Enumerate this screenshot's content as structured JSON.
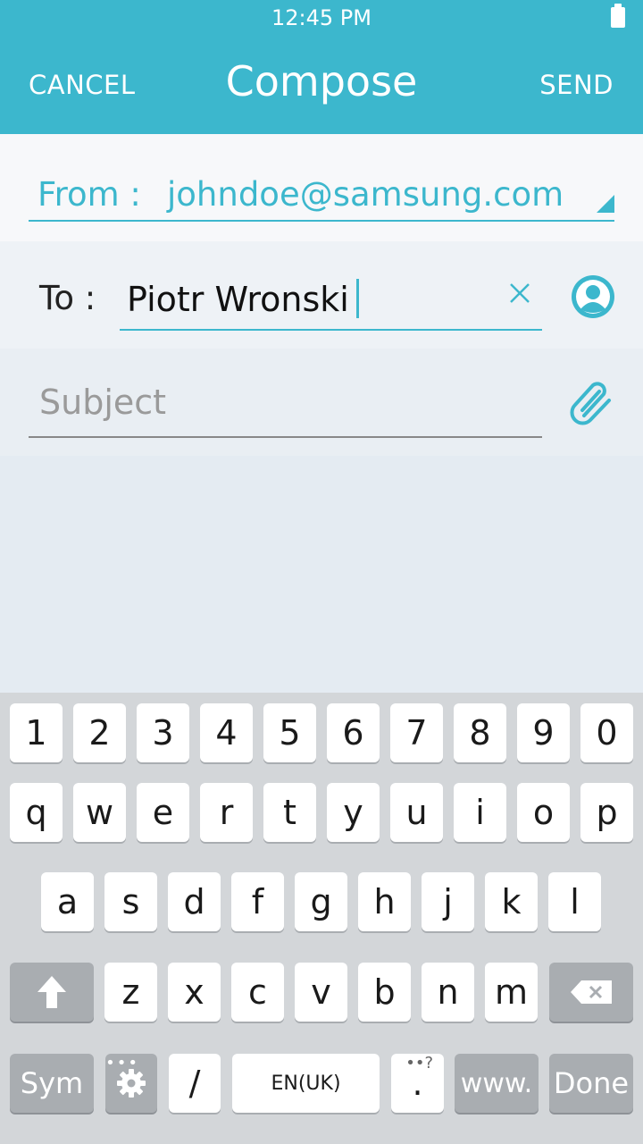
{
  "status": {
    "time": "12:45 PM"
  },
  "header": {
    "cancel_label": "CANCEL",
    "title": "Compose",
    "send_label": "SEND"
  },
  "from": {
    "label": "From :",
    "value": "johndoe@samsung.com"
  },
  "to": {
    "label": "To :",
    "value": "Piotr Wronski"
  },
  "subject": {
    "placeholder": "Subject"
  },
  "keyboard": {
    "row1": [
      "1",
      "2",
      "3",
      "4",
      "5",
      "6",
      "7",
      "8",
      "9",
      "0"
    ],
    "row2": [
      "q",
      "w",
      "e",
      "r",
      "t",
      "y",
      "u",
      "i",
      "o",
      "p"
    ],
    "row3": [
      "a",
      "s",
      "d",
      "f",
      "g",
      "h",
      "j",
      "k",
      "l"
    ],
    "row4": [
      "z",
      "x",
      "c",
      "v",
      "b",
      "n",
      "m"
    ],
    "sym_label": "Sym",
    "settings_dots": "•••",
    "slash_label": "/",
    "space_label": "EN(UK)",
    "period_label": ".",
    "period_sup": "••?",
    "www_label": "www.",
    "done_label": "Done"
  },
  "colors": {
    "accent": "#3cb7cd",
    "keyboard_bg": "#d3d6d9",
    "dark_key": "#a9adb1"
  }
}
